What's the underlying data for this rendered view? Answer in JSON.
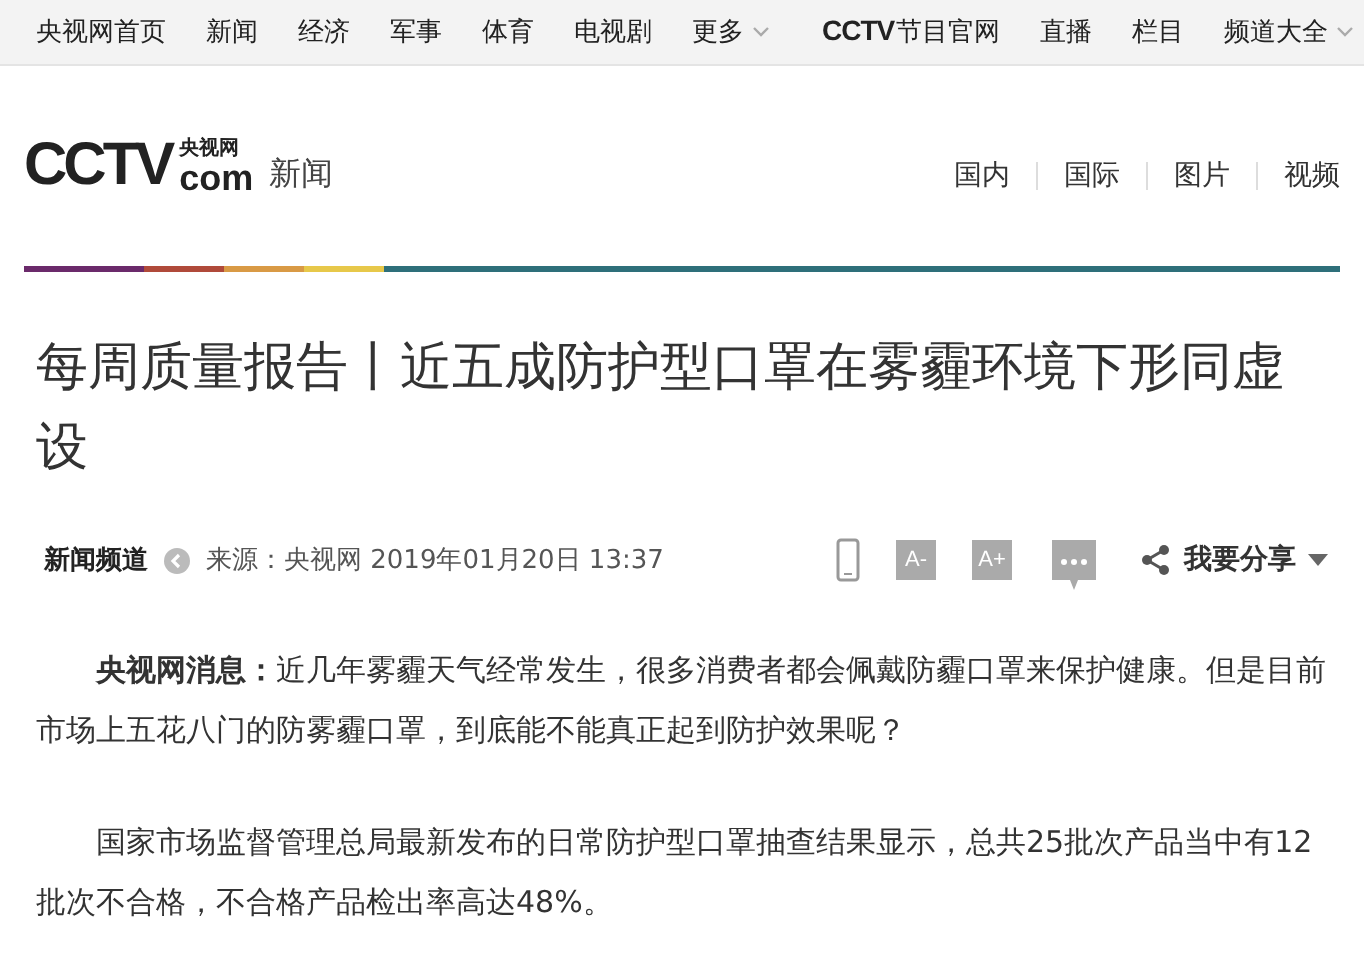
{
  "top_nav": {
    "items": [
      {
        "label": "央视网首页",
        "dropdown": false
      },
      {
        "label": "新闻",
        "dropdown": false
      },
      {
        "label": "经济",
        "dropdown": false
      },
      {
        "label": "军事",
        "dropdown": false
      },
      {
        "label": "体育",
        "dropdown": false
      },
      {
        "label": "电视剧",
        "dropdown": false
      },
      {
        "label": "更多",
        "dropdown": true
      }
    ],
    "brand": {
      "logo": "CCTV",
      "label": "节目官网"
    },
    "right_items": [
      {
        "label": "直播",
        "dropdown": false
      },
      {
        "label": "栏目",
        "dropdown": false
      },
      {
        "label": "频道大全",
        "dropdown": true
      }
    ]
  },
  "header": {
    "logo": {
      "letters": "CCTV",
      "site": "央视网",
      "domain": "com"
    },
    "section": "新闻",
    "nav": [
      "国内",
      "国际",
      "图片",
      "视频"
    ]
  },
  "article": {
    "title": "每周质量报告丨近五成防护型口罩在雾霾环境下形同虚设",
    "meta": {
      "channel": "新闻频道",
      "source": "来源：央视网 2019年01月20日 13:37",
      "share": "我要分享"
    },
    "font_buttons": [
      "A-",
      "A+"
    ],
    "paragraphs": [
      "**央视网消息：**近几年雾霾天气经常发生，很多消费者都会佩戴防霾口罩来保护健康。但是目前市场上五花八门的防雾霾口罩，到底能不能真正起到防护效果呢？",
      "国家市场监督管理总局最新发布的日常防护型口罩抽查结果显示，总共25批次产品当中有12批次不合格，不合格产品检出率高达48%。"
    ]
  }
}
